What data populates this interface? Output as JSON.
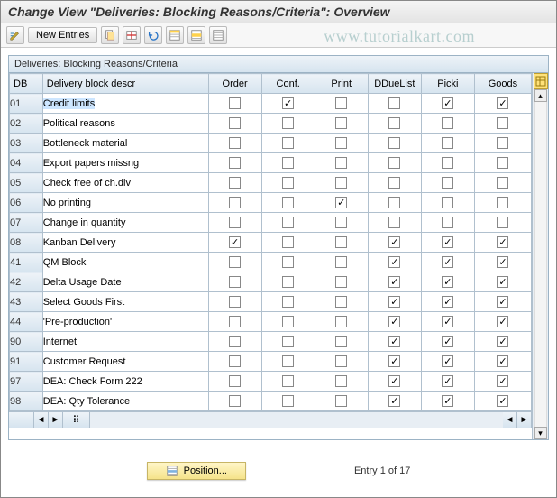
{
  "title": "Change View \"Deliveries: Blocking Reasons/Criteria\": Overview",
  "watermark": "www.tutorialkart.com",
  "toolbar": {
    "new_entries": "New Entries"
  },
  "panel": {
    "title": "Deliveries: Blocking Reasons/Criteria"
  },
  "columns": {
    "db": "DB",
    "descr": "Delivery block descr",
    "order": "Order",
    "conf": "Conf.",
    "print": "Print",
    "dduelist": "DDueList",
    "picki": "Picki",
    "goods": "Goods"
  },
  "rows": [
    {
      "db": "01",
      "descr": "Credit limits",
      "order": false,
      "conf": true,
      "print": false,
      "dduelist": false,
      "picki": true,
      "goods": true,
      "selected": true
    },
    {
      "db": "02",
      "descr": "Political reasons",
      "order": false,
      "conf": false,
      "print": false,
      "dduelist": false,
      "picki": false,
      "goods": false
    },
    {
      "db": "03",
      "descr": "Bottleneck material",
      "order": false,
      "conf": false,
      "print": false,
      "dduelist": false,
      "picki": false,
      "goods": false
    },
    {
      "db": "04",
      "descr": "Export papers missng",
      "order": false,
      "conf": false,
      "print": false,
      "dduelist": false,
      "picki": false,
      "goods": false
    },
    {
      "db": "05",
      "descr": "Check free of ch.dlv",
      "order": false,
      "conf": false,
      "print": false,
      "dduelist": false,
      "picki": false,
      "goods": false
    },
    {
      "db": "06",
      "descr": "No printing",
      "order": false,
      "conf": false,
      "print": true,
      "dduelist": false,
      "picki": false,
      "goods": false
    },
    {
      "db": "07",
      "descr": "Change in quantity",
      "order": false,
      "conf": false,
      "print": false,
      "dduelist": false,
      "picki": false,
      "goods": false
    },
    {
      "db": "08",
      "descr": "Kanban Delivery",
      "order": true,
      "conf": false,
      "print": false,
      "dduelist": true,
      "picki": true,
      "goods": true
    },
    {
      "db": "41",
      "descr": "QM Block",
      "order": false,
      "conf": false,
      "print": false,
      "dduelist": true,
      "picki": true,
      "goods": true
    },
    {
      "db": "42",
      "descr": "Delta Usage Date",
      "order": false,
      "conf": false,
      "print": false,
      "dduelist": true,
      "picki": true,
      "goods": true
    },
    {
      "db": "43",
      "descr": "Select Goods First",
      "order": false,
      "conf": false,
      "print": false,
      "dduelist": true,
      "picki": true,
      "goods": true
    },
    {
      "db": "44",
      "descr": "'Pre-production'",
      "order": false,
      "conf": false,
      "print": false,
      "dduelist": true,
      "picki": true,
      "goods": true
    },
    {
      "db": "90",
      "descr": "Internet",
      "order": false,
      "conf": false,
      "print": false,
      "dduelist": true,
      "picki": true,
      "goods": true
    },
    {
      "db": "91",
      "descr": "Customer Request",
      "order": false,
      "conf": false,
      "print": false,
      "dduelist": true,
      "picki": true,
      "goods": true
    },
    {
      "db": "97",
      "descr": "DEA: Check Form 222",
      "order": false,
      "conf": false,
      "print": false,
      "dduelist": true,
      "picki": true,
      "goods": true
    },
    {
      "db": "98",
      "descr": "DEA: Qty Tolerance",
      "order": false,
      "conf": false,
      "print": false,
      "dduelist": true,
      "picki": true,
      "goods": true
    }
  ],
  "footer": {
    "position": "Position...",
    "entry": "Entry 1 of 17"
  }
}
